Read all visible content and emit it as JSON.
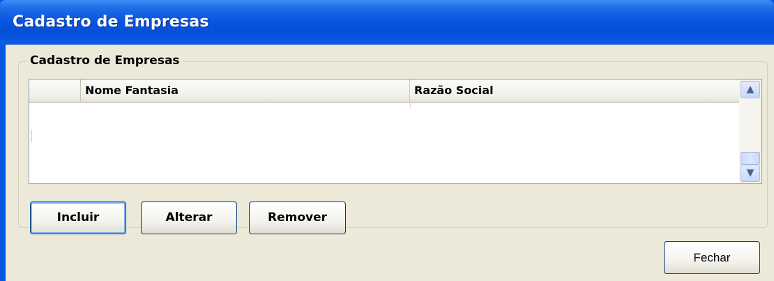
{
  "window": {
    "title": "Cadastro de Empresas"
  },
  "groupbox": {
    "legend": "Cadastro de Empresas"
  },
  "grid": {
    "columns": [
      "",
      "Nome Fantasia",
      "Razão Social"
    ],
    "rows": []
  },
  "buttons": {
    "incluir": "Incluir",
    "alterar": "Alterar",
    "remover": "Remover",
    "fechar": "Fechar"
  },
  "icons": {
    "scroll_up": "chevron-up-icon",
    "scroll_down": "chevron-down-icon"
  },
  "colors": {
    "titlebar": "#0a55e3",
    "client_bg": "#ece9d8",
    "button_border": "#003c74"
  }
}
